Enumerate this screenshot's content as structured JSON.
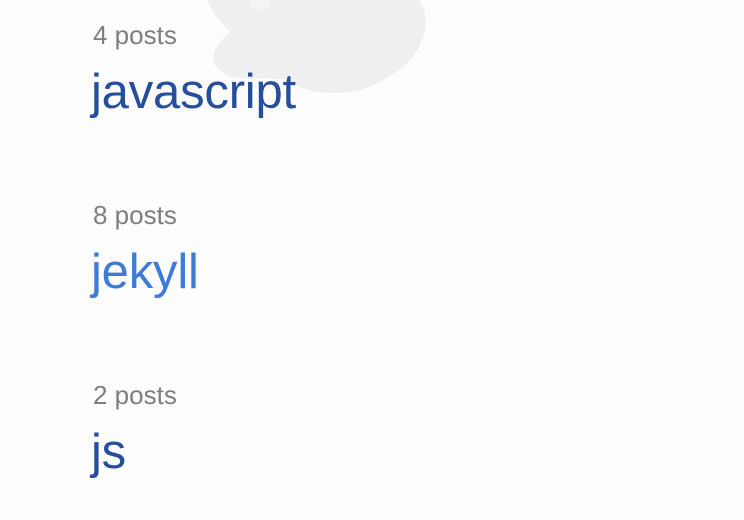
{
  "colors": {
    "background": "#fdfdfd",
    "count_text": "#7e7e7e",
    "link_default": "#254e9c",
    "link_hover": "#3d7bd9",
    "watermark": "#e6e6e6"
  },
  "tags": [
    {
      "count_label": "4 posts",
      "name": "javascript",
      "state": "default"
    },
    {
      "count_label": "8 posts",
      "name": "jekyll",
      "state": "hover"
    },
    {
      "count_label": "2 posts",
      "name": "js",
      "state": "default"
    }
  ]
}
